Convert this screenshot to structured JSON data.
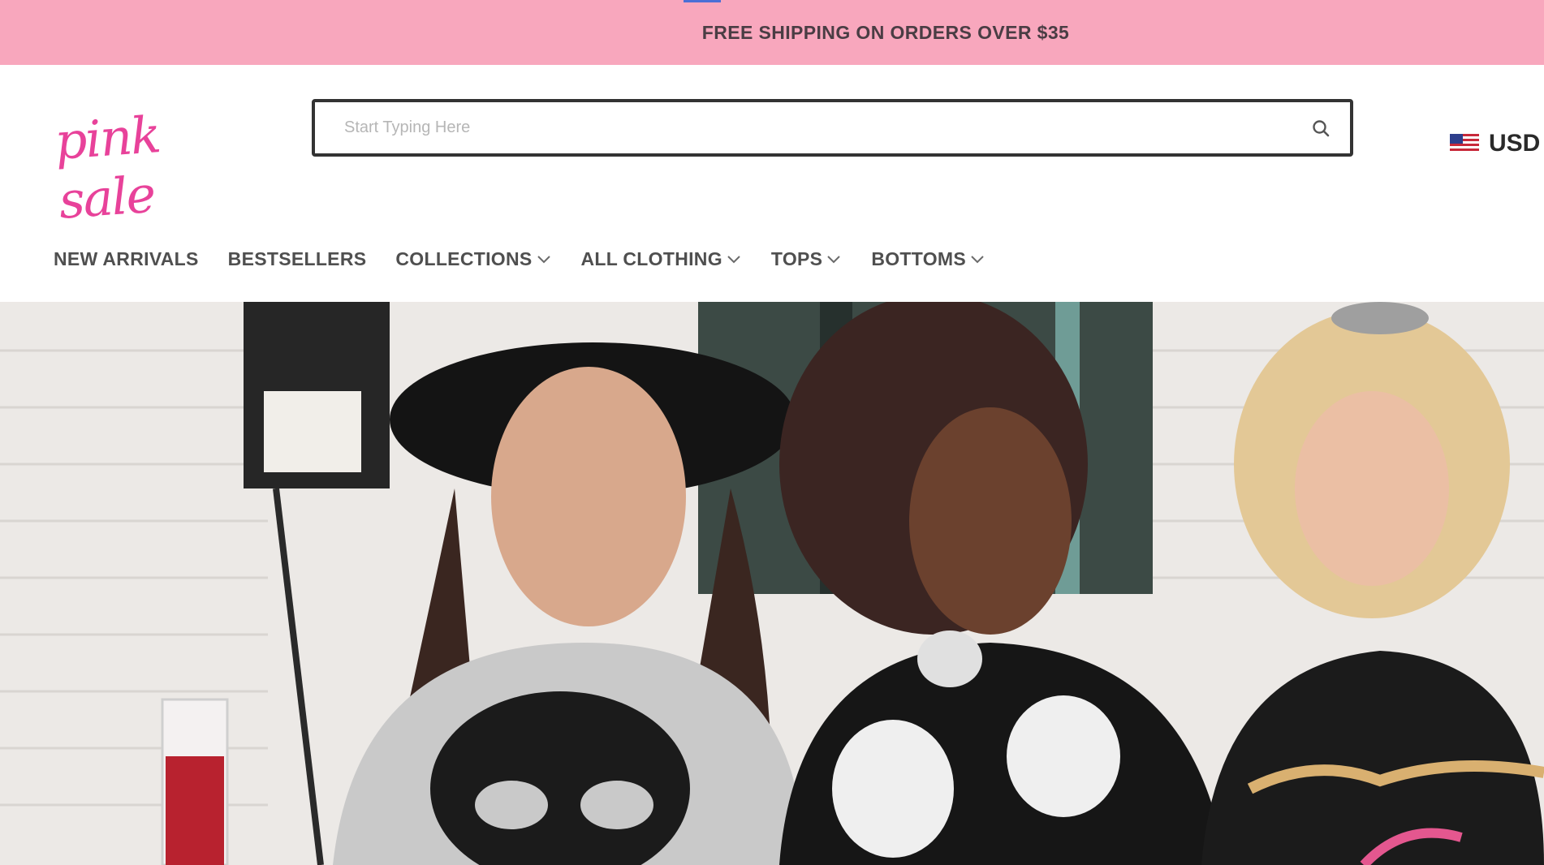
{
  "promo": {
    "text": "FREE SHIPPING ON ORDERS OVER $35"
  },
  "header": {
    "logo_text": "pink sale",
    "search": {
      "placeholder": "Start Typing Here",
      "value": ""
    },
    "currency": {
      "label": "USD",
      "flag": "us-flag-icon"
    }
  },
  "nav": {
    "items": [
      {
        "label": "NEW ARRIVALS",
        "dropdown": false
      },
      {
        "label": "BESTSELLERS",
        "dropdown": false
      },
      {
        "label": "COLLECTIONS",
        "dropdown": true
      },
      {
        "label": "ALL CLOTHING",
        "dropdown": true
      },
      {
        "label": "TOPS",
        "dropdown": true
      },
      {
        "label": "BOTTOMS",
        "dropdown": true
      }
    ]
  },
  "colors": {
    "promo_bg": "#f8a7bd",
    "brand_pink": "#e8429a",
    "nav_text": "#4f4f4f"
  }
}
